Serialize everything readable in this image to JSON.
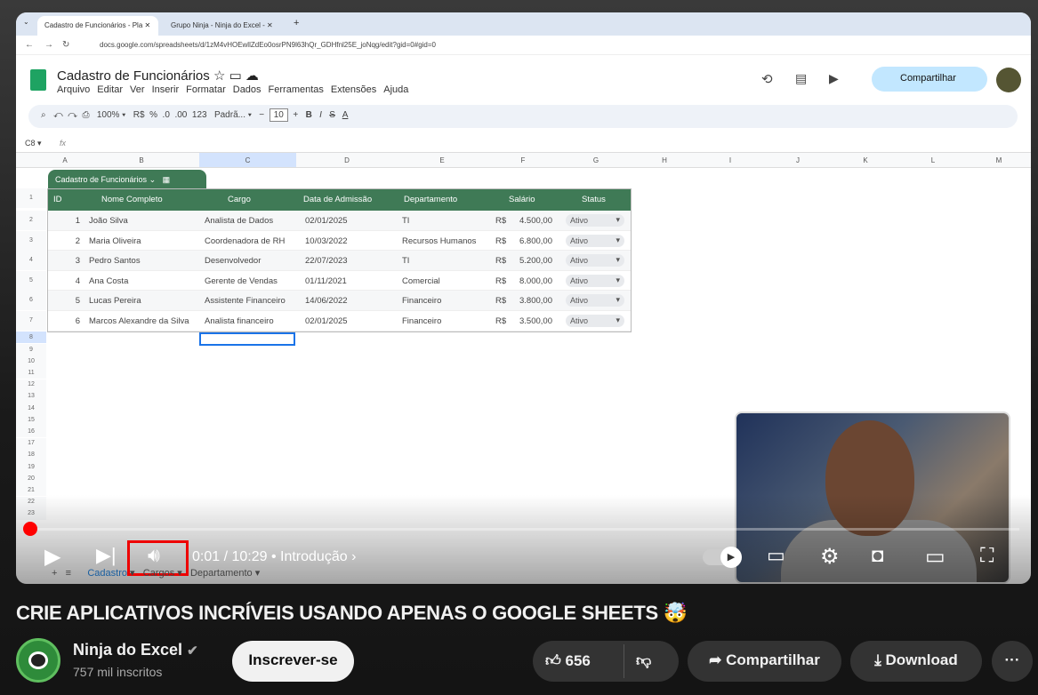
{
  "browser": {
    "tabs": [
      {
        "label": "Cadastro de Funcionários - Pla"
      },
      {
        "label": "Grupo Ninja - Ninja do Excel - "
      }
    ],
    "url": "docs.google.com/spreadsheets/d/1zM4vHOEwllZdEo0osrPN9l63hQr_GDHfnl25E_joNqg/edit?gid=0#gid=0"
  },
  "sheets": {
    "title": "Cadastro de Funcionários",
    "menu": [
      "Arquivo",
      "Editar",
      "Ver",
      "Inserir",
      "Formatar",
      "Dados",
      "Ferramentas",
      "Extensões",
      "Ajuda"
    ],
    "share_label": "Compartilhar",
    "zoom": "100%",
    "currency": "R$",
    "percent": "%",
    "number_format": "123",
    "font": "Padrã...",
    "font_size": "10",
    "cell_ref": "C8",
    "fx": "fx",
    "columns": [
      "A",
      "B",
      "C",
      "D",
      "E",
      "F",
      "G",
      "H",
      "I",
      "J",
      "K",
      "L",
      "M"
    ],
    "rows": [
      "1",
      "2",
      "3",
      "4",
      "5",
      "6",
      "7",
      "8",
      "9",
      "10",
      "11",
      "12",
      "13",
      "14",
      "15",
      "16",
      "17",
      "18",
      "19",
      "20",
      "21",
      "22",
      "23"
    ],
    "table_name": "Cadastro de Funcionários",
    "headers": [
      "ID",
      "Nome Completo",
      "Cargo",
      "Data de Admissão",
      "Departamento",
      "Salário",
      "Status"
    ],
    "data": [
      [
        "1",
        "João Silva",
        "Analista de Dados",
        "02/01/2025",
        "TI",
        "R$",
        "4.500,00",
        "Ativo"
      ],
      [
        "2",
        "Maria Oliveira",
        "Coordenadora de RH",
        "10/03/2022",
        "Recursos Humanos",
        "R$",
        "6.800,00",
        "Ativo"
      ],
      [
        "3",
        "Pedro Santos",
        "Desenvolvedor",
        "22/07/2023",
        "TI",
        "R$",
        "5.200,00",
        "Ativo"
      ],
      [
        "4",
        "Ana Costa",
        "Gerente de Vendas",
        "01/11/2021",
        "Comercial",
        "R$",
        "8.000,00",
        "Ativo"
      ],
      [
        "5",
        "Lucas Pereira",
        "Assistente Financeiro",
        "14/06/2022",
        "Financeiro",
        "R$",
        "3.800,00",
        "Ativo"
      ],
      [
        "6",
        "Marcos Alexandre da Silva",
        "Analista financeiro",
        "02/01/2025",
        "Financeiro",
        "R$",
        "3.500,00",
        "Ativo"
      ]
    ],
    "sheet_tabs": [
      "Cadastro",
      "Cargos",
      "Departamento"
    ]
  },
  "player": {
    "time": "0:01 / 10:29",
    "chapter": "• Introdução",
    "progress_fraction": 0.0016
  },
  "video": {
    "title": "CRIE APLICATIVOS INCRÍVEIS USANDO APENAS O GOOGLE SHEETS 🤯",
    "channel": "Ninja do Excel",
    "subscribers": "757 mil inscritos",
    "subscribe_label": "Inscrever-se",
    "likes": "656",
    "share_label": "Compartilhar",
    "download_label": "Download",
    "more": "···"
  },
  "colors": {
    "accent": "#ff0000",
    "table_header": "#3f7a56",
    "highlight_box": "#e00000"
  }
}
